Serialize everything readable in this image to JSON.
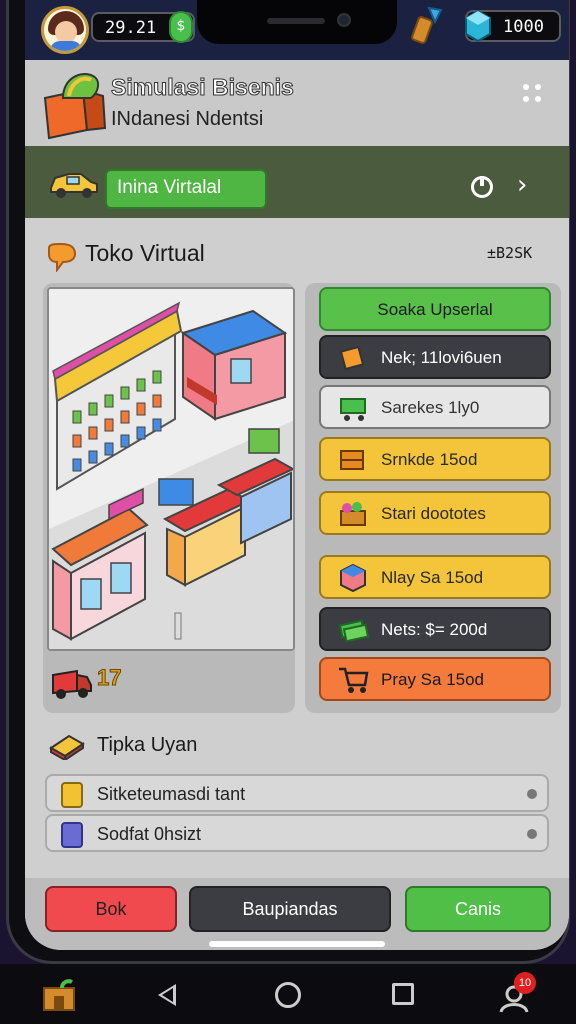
{
  "status": {
    "coins": "29.21",
    "gems": "1000"
  },
  "header": {
    "title": "Simulasi Bisenis",
    "subtitle": "INdanesi Ndentsi"
  },
  "banner": {
    "button_label": "Inina Virtalal"
  },
  "shop": {
    "title": "Toko Virtual",
    "code": "±B2SK",
    "delivery_count": "17"
  },
  "actions": [
    {
      "label": "Soaka Upserlal",
      "style": "green",
      "icon": "none"
    },
    {
      "label": "Nek; 11lovi6uen",
      "style": "dark",
      "icon": "box-icon"
    },
    {
      "label": "Sarekes 1ly0",
      "style": "light",
      "icon": "cash-cart-icon"
    },
    {
      "label": "Srnkde 15od",
      "style": "yellow",
      "icon": "crate-icon"
    },
    {
      "label": "Stari doototes",
      "style": "yellow",
      "icon": "produce-crate-icon"
    },
    {
      "label": "Nlay Sa 15od",
      "style": "yellow",
      "icon": "cube-icon"
    },
    {
      "label": "Nets: $= 200d",
      "style": "dark",
      "icon": "money-icon"
    },
    {
      "label": "Pray Sa 15od",
      "style": "orange",
      "icon": "shopping-cart-icon"
    }
  ],
  "list": {
    "title": "Tipka Uyan",
    "items": [
      {
        "label": "Sitketeumasdi tant",
        "color": "#f2c232"
      },
      {
        "label": "Sodfat 0hsizt",
        "color": "#6b6bd4"
      }
    ]
  },
  "bottom": {
    "left": "Bok",
    "middle": "Baupiandas",
    "right": "Canis"
  },
  "nav": {
    "badge": "10"
  },
  "colors": {
    "green": "#59c14a",
    "yellow": "#f4c53a",
    "orange": "#f57b3c",
    "red": "#f04a4e",
    "dark": "#3c3d42",
    "topbar": "#1b2140"
  }
}
